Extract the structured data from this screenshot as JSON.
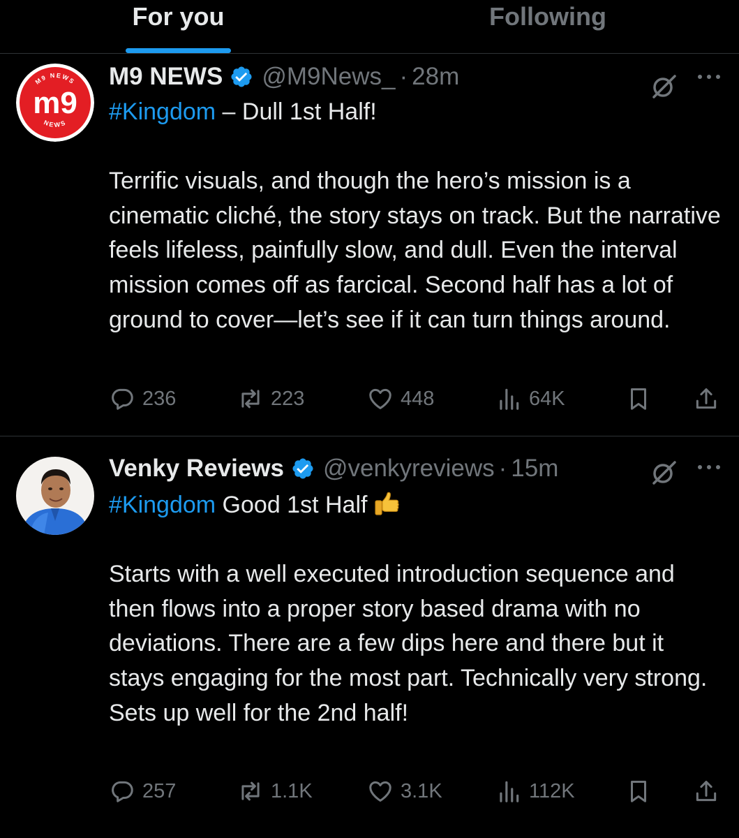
{
  "tabs": [
    {
      "label": "For you",
      "active": true
    },
    {
      "label": "Following",
      "active": false
    }
  ],
  "colors": {
    "accent": "#1d9bf0",
    "text": "#e7e9ea",
    "muted": "#71767b",
    "background": "#000000",
    "divider": "#2f3336"
  },
  "tweets": [
    {
      "author": {
        "name": "M9 NEWS",
        "handle": "@M9News_",
        "verified": true,
        "avatar_logo": {
          "main": "m9",
          "top_arc": "M9 NEWS",
          "bottom_arc": "NEWS"
        }
      },
      "separator": "·",
      "time": "28m",
      "hashtag": "#Kingdom",
      "headline_rest": " – Dull 1st Half!",
      "paragraph": "Terrific visuals, and though the hero’s mission is a cinematic cliché, the story stays on track. But the narrative feels lifeless, painfully slow, and dull. Even the interval mission comes off as farcical. Second half has a lot of ground to cover—let’s see if it can turn things around.",
      "stats": {
        "replies": "236",
        "reposts": "223",
        "likes": "448",
        "views": "64K"
      }
    },
    {
      "author": {
        "name": "Venky Reviews",
        "handle": "@venkyreviews",
        "verified": true,
        "avatar_logo": null
      },
      "separator": "·",
      "time": "15m",
      "hashtag": "#Kingdom",
      "headline_rest": " Good 1st Half",
      "headline_emoji": "thumbs-up-emoji",
      "paragraph": "Starts with a well executed introduction sequence and then flows into a proper story based drama with no deviations. There are a few dips here and there but it stays engaging for the most part. Technically very strong. Sets up well for the 2nd half!",
      "stats": {
        "replies": "257",
        "reposts": "1.1K",
        "likes": "3.1K",
        "views": "112K"
      }
    }
  ],
  "icons": {
    "verified": "verified-badge-icon",
    "grok": "grok-icon",
    "more": "more-icon",
    "reply": "reply-icon",
    "repost": "repost-icon",
    "like": "like-icon",
    "views": "views-icon",
    "bookmark": "bookmark-icon",
    "share": "share-icon"
  }
}
